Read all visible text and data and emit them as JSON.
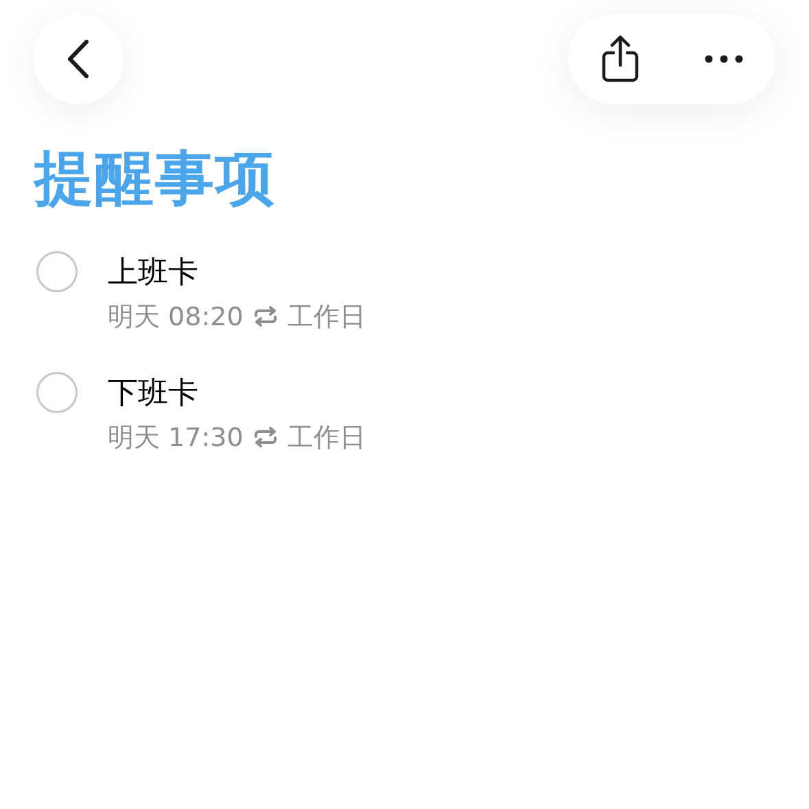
{
  "title": "提醒事项",
  "reminders": [
    {
      "title": "上班卡",
      "time": "明天 08:20",
      "repeat": "工作日",
      "checked": false
    },
    {
      "title": "下班卡",
      "time": "明天 17:30",
      "repeat": "工作日",
      "checked": false
    }
  ]
}
